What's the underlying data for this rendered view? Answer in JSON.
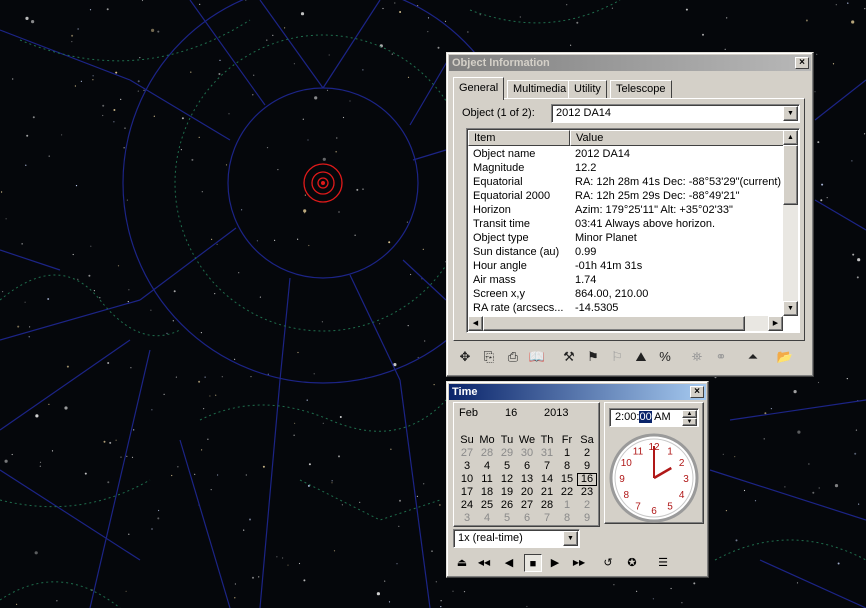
{
  "object_info": {
    "title": "Object Information",
    "close_glyph": "×",
    "tabs": [
      "General",
      "Multimedia",
      "Utility",
      "Telescope"
    ],
    "object_label": "Object (1 of 2):",
    "object_selected": "2012 DA14",
    "columns": [
      "Item",
      "Value"
    ],
    "rows": [
      {
        "item": "Object name",
        "value": "2012 DA14"
      },
      {
        "item": "Magnitude",
        "value": "12.2"
      },
      {
        "item": "Equatorial",
        "value": "RA: 12h 28m 41s   Dec: -88°53'29\"(current)"
      },
      {
        "item": "Equatorial 2000",
        "value": "RA: 12h 25m 29s   Dec: -88°49'21\""
      },
      {
        "item": "Horizon",
        "value": "Azim: 179°25'11\"   Alt: +35°02'33\""
      },
      {
        "item": "Transit time",
        "value": "03:41  Always above horizon."
      },
      {
        "item": "Object type",
        "value": "Minor Planet"
      },
      {
        "item": "Sun distance (au)",
        "value": "0.99"
      },
      {
        "item": "Hour angle",
        "value": "-01h 41m 31s"
      },
      {
        "item": "Air mass",
        "value": "1.74"
      },
      {
        "item": "Screen x,y",
        "value": "864.00, 210.00"
      },
      {
        "item": "RA rate (arcsecs...",
        "value": "-14.5305"
      }
    ],
    "toolbar": [
      {
        "name": "center-object-icon",
        "glyph": "✥",
        "dim": false
      },
      {
        "name": "copy-icon",
        "glyph": "⎘",
        "dim": false
      },
      {
        "name": "print-icon",
        "glyph": "⎙",
        "dim": false
      },
      {
        "name": "book-icon",
        "glyph": "📖",
        "dim": false
      },
      {
        "name": "telescope-slew-icon",
        "glyph": "⚒",
        "dim": false
      },
      {
        "name": "telescope-sync-icon",
        "glyph": "⚑",
        "dim": false
      },
      {
        "name": "telescope-park-icon",
        "glyph": "⚐",
        "dim": true
      },
      {
        "name": "track-object-icon",
        "glyph": "⛰",
        "dim": false
      },
      {
        "name": "rate-icon",
        "glyph": "%",
        "dim": false
      },
      {
        "name": "globe-icon",
        "glyph": "⛯",
        "dim": true
      },
      {
        "name": "link-icon",
        "glyph": "⚭",
        "dim": true
      },
      {
        "name": "collapse-up-icon",
        "glyph": "⏶",
        "dim": false
      },
      {
        "name": "open-folder-icon",
        "glyph": "📂",
        "dim": false
      }
    ]
  },
  "time_window": {
    "title": "Time",
    "close_glyph": "×",
    "month": "Feb",
    "day": "16",
    "year": "2013",
    "weekdays": [
      "Su",
      "Mo",
      "Tu",
      "We",
      "Th",
      "Fr",
      "Sa"
    ],
    "weeks": [
      [
        {
          "d": "27",
          "o": true
        },
        {
          "d": "28",
          "o": true
        },
        {
          "d": "29",
          "o": true
        },
        {
          "d": "30",
          "o": true
        },
        {
          "d": "31",
          "o": true
        },
        {
          "d": "1",
          "o": false
        },
        {
          "d": "2",
          "o": false
        }
      ],
      [
        {
          "d": "3",
          "o": false
        },
        {
          "d": "4",
          "o": false
        },
        {
          "d": "5",
          "o": false
        },
        {
          "d": "6",
          "o": false
        },
        {
          "d": "7",
          "o": false
        },
        {
          "d": "8",
          "o": false
        },
        {
          "d": "9",
          "o": false
        }
      ],
      [
        {
          "d": "10",
          "o": false
        },
        {
          "d": "11",
          "o": false
        },
        {
          "d": "12",
          "o": false
        },
        {
          "d": "13",
          "o": false
        },
        {
          "d": "14",
          "o": false
        },
        {
          "d": "15",
          "o": false
        },
        {
          "d": "16",
          "o": false,
          "today": true
        }
      ],
      [
        {
          "d": "17",
          "o": false
        },
        {
          "d": "18",
          "o": false
        },
        {
          "d": "19",
          "o": false
        },
        {
          "d": "20",
          "o": false
        },
        {
          "d": "21",
          "o": false
        },
        {
          "d": "22",
          "o": false
        },
        {
          "d": "23",
          "o": false
        }
      ],
      [
        {
          "d": "24",
          "o": false
        },
        {
          "d": "25",
          "o": false
        },
        {
          "d": "26",
          "o": false
        },
        {
          "d": "27",
          "o": false
        },
        {
          "d": "28",
          "o": false
        },
        {
          "d": "1",
          "o": true
        },
        {
          "d": "2",
          "o": true
        }
      ],
      [
        {
          "d": "3",
          "o": true
        },
        {
          "d": "4",
          "o": true
        },
        {
          "d": "5",
          "o": true
        },
        {
          "d": "6",
          "o": true
        },
        {
          "d": "7",
          "o": true
        },
        {
          "d": "8",
          "o": true
        },
        {
          "d": "9",
          "o": true
        }
      ]
    ],
    "time_hm": "2:00:",
    "time_sec": "00",
    "time_ampm": "AM",
    "clock": {
      "hours": 2,
      "minutes": 0,
      "numerals": [
        "12",
        "1",
        "2",
        "3",
        "4",
        "5",
        "6",
        "7",
        "8",
        "9",
        "10",
        "11"
      ],
      "numeral_color": "#b01818",
      "hand_color": "#b01818"
    },
    "rate": "1x (real-time)",
    "controls": [
      {
        "name": "step-mode-icon",
        "glyph": "⏏"
      },
      {
        "name": "fast-reverse-button",
        "glyph": "◀◀"
      },
      {
        "name": "reverse-button",
        "glyph": "◀"
      },
      {
        "name": "stop-button",
        "glyph": "■",
        "pressed": true
      },
      {
        "name": "forward-button",
        "glyph": "▶"
      },
      {
        "name": "fast-forward-button",
        "glyph": "▶▶"
      },
      {
        "name": "set-now-icon",
        "glyph": "↺"
      },
      {
        "name": "sidereal-icon",
        "glyph": "✪"
      },
      {
        "name": "time-details-icon",
        "glyph": "☰"
      }
    ]
  },
  "colors": {
    "sky": "#05070b",
    "grid_lines": "#1c2486",
    "constellation_dots": "#1f6e4d",
    "target_marker": "#e01a1a"
  }
}
